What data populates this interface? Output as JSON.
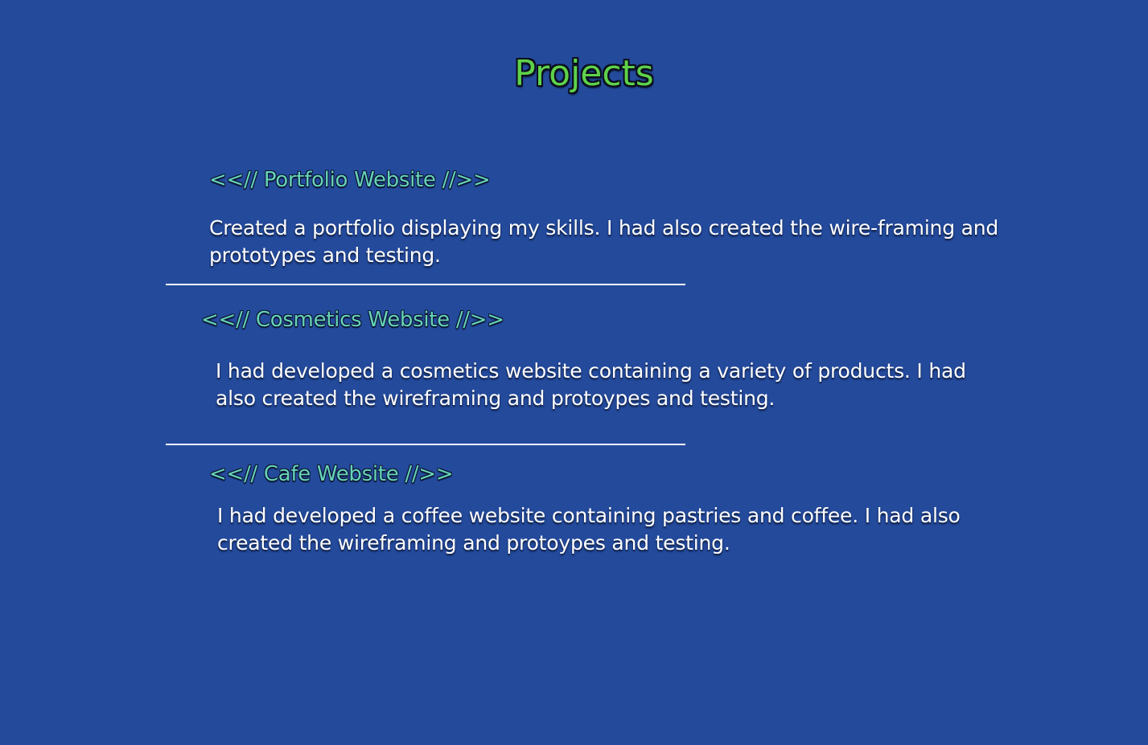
{
  "page": {
    "heading": "Projects"
  },
  "projects": [
    {
      "title": "<<// Portfolio Website //>>",
      "description": "Created a portfolio displaying my skills. I had also created the wire-framing and prototypes and testing."
    },
    {
      "title": "<<// Cosmetics Website //>>",
      "description": "I had developed a cosmetics website containing a variety of products. I had also created the wireframing and protoypes and testing."
    },
    {
      "title": "<<// Cafe Website //>>",
      "description": "I had developed a coffee website containing pastries and coffee. I had also created the wireframing and protoypes and testing."
    }
  ],
  "colors": {
    "background": "#244a9c",
    "heading": "#5fd24a",
    "project_title": "#67d3b9",
    "text": "#ffffff"
  }
}
